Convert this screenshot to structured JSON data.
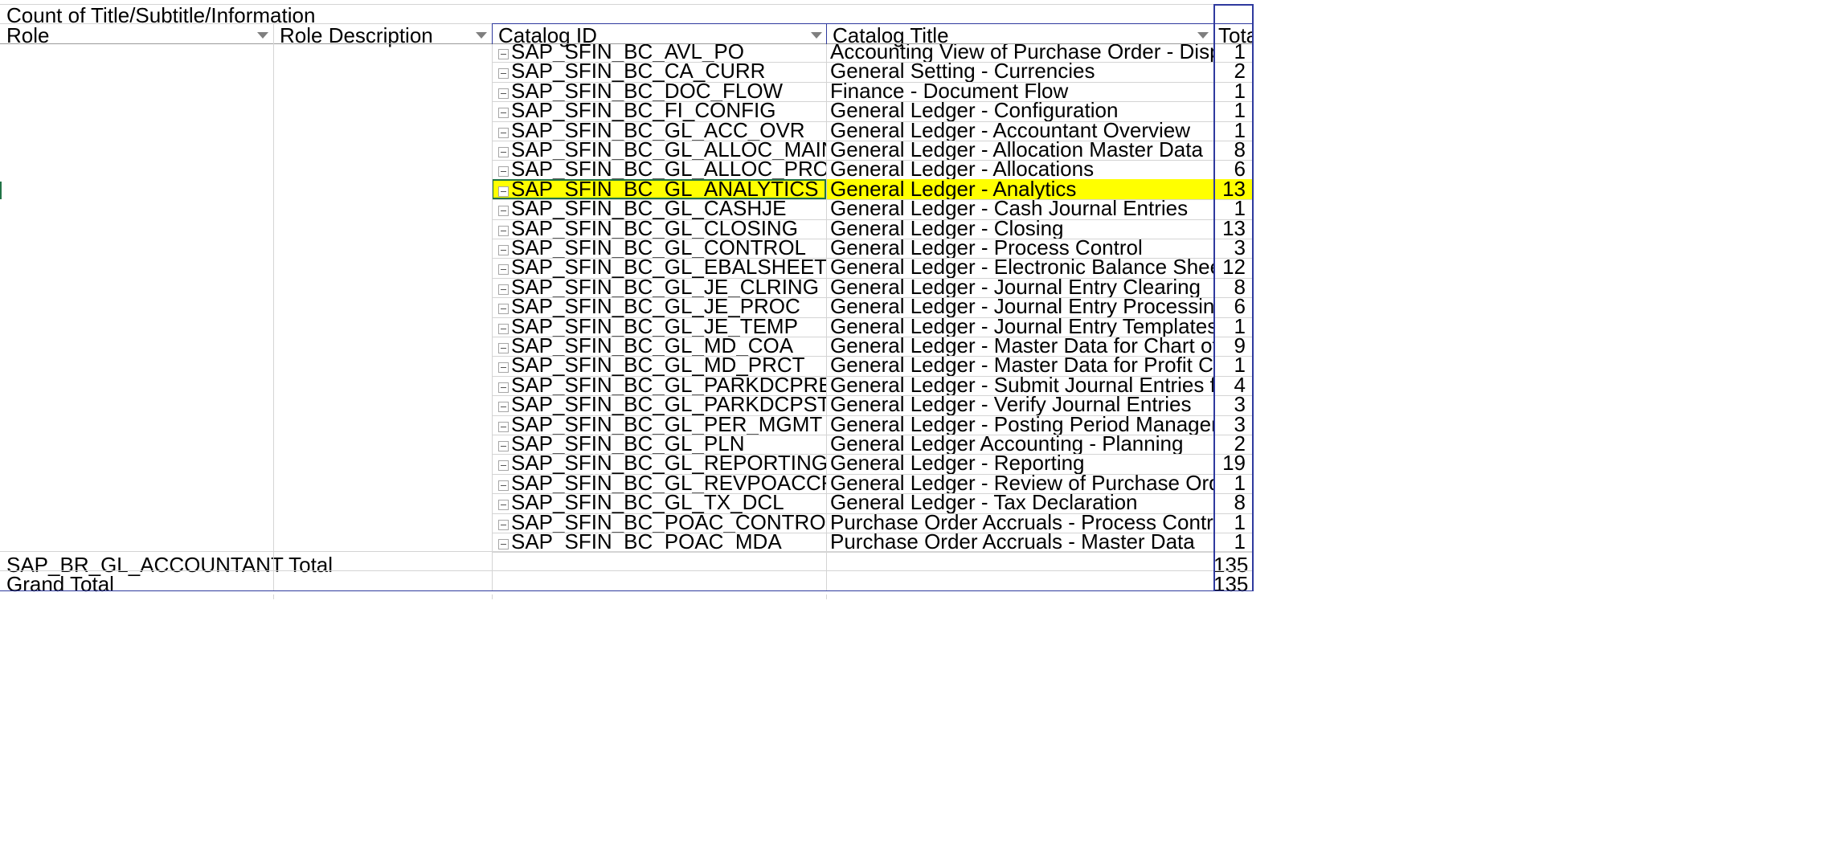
{
  "pivot": {
    "title": "Count of Title/Subtitle/Information",
    "headers": {
      "role": "Role",
      "role_description": "Role Description",
      "catalog_id": "Catalog ID",
      "catalog_title": "Catalog Title",
      "total": "Total"
    },
    "rows": [
      {
        "id": "SAP_SFIN_BC_AVL_PO",
        "title": "Accounting View of Purchase Order - Display",
        "total": "1"
      },
      {
        "id": "SAP_SFIN_BC_CA_CURR",
        "title": "General Setting - Currencies",
        "total": "2"
      },
      {
        "id": "SAP_SFIN_BC_DOC_FLOW",
        "title": "Finance - Document Flow",
        "total": "1"
      },
      {
        "id": "SAP_SFIN_BC_FI_CONFIG",
        "title": "General Ledger - Configuration",
        "total": "1"
      },
      {
        "id": "SAP_SFIN_BC_GL_ACC_OVR",
        "title": "General Ledger - Accountant Overview",
        "total": "1"
      },
      {
        "id": "SAP_SFIN_BC_GL_ALLOC_MAINT",
        "title": "General Ledger - Allocation Master Data",
        "total": "8"
      },
      {
        "id": "SAP_SFIN_BC_GL_ALLOC_PROC",
        "title": "General Ledger - Allocations",
        "total": "6"
      },
      {
        "id": "SAP_SFIN_BC_GL_ANALYTICS",
        "title": "General Ledger - Analytics",
        "total": "13"
      },
      {
        "id": "SAP_SFIN_BC_GL_CASHJE",
        "title": "General Ledger - Cash Journal Entries",
        "total": "1"
      },
      {
        "id": "SAP_SFIN_BC_GL_CLOSING",
        "title": "General Ledger - Closing",
        "total": "13"
      },
      {
        "id": "SAP_SFIN_BC_GL_CONTROL",
        "title": "General Ledger - Process Control",
        "total": "3"
      },
      {
        "id": "SAP_SFIN_BC_GL_EBALSHEET",
        "title": "General Ledger - Electronic Balance Sheet",
        "total": "12"
      },
      {
        "id": "SAP_SFIN_BC_GL_JE_CLRING",
        "title": "General Ledger - Journal Entry Clearing",
        "total": "8"
      },
      {
        "id": "SAP_SFIN_BC_GL_JE_PROC",
        "title": "General Ledger - Journal Entry Processing",
        "total": "6"
      },
      {
        "id": "SAP_SFIN_BC_GL_JE_TEMP",
        "title": "General Ledger - Journal Entry Templates",
        "total": "1"
      },
      {
        "id": "SAP_SFIN_BC_GL_MD_COA",
        "title": "General Ledger - Master Data for Chart of Accounts",
        "total": "9"
      },
      {
        "id": "SAP_SFIN_BC_GL_MD_PRCT",
        "title": "General Ledger - Master Data for Profit Center",
        "total": "1"
      },
      {
        "id": "SAP_SFIN_BC_GL_PARKDCPRE",
        "title": "General Ledger - Submit Journal Entries for Verification",
        "total": "4"
      },
      {
        "id": "SAP_SFIN_BC_GL_PARKDCPST",
        "title": "General Ledger - Verify Journal Entries",
        "total": "3"
      },
      {
        "id": "SAP_SFIN_BC_GL_PER_MGMT",
        "title": "General Ledger - Posting Period Management",
        "total": "3"
      },
      {
        "id": "SAP_SFIN_BC_GL_PLN",
        "title": "General Ledger Accounting - Planning",
        "total": "2"
      },
      {
        "id": "SAP_SFIN_BC_GL_REPORTING",
        "title": "General Ledger - Reporting",
        "total": "19"
      },
      {
        "id": "SAP_SFIN_BC_GL_REVPOACCR",
        "title": "General Ledger - Review of Purchase Order Accruals",
        "total": "1"
      },
      {
        "id": "SAP_SFIN_BC_GL_TX_DCL",
        "title": "General Ledger - Tax Declaration",
        "total": "8"
      },
      {
        "id": "SAP_SFIN_BC_POAC_CONTROL",
        "title": "Purchase Order Accruals - Process Control",
        "total": "1"
      },
      {
        "id": "SAP_SFIN_BC_POAC_MDA",
        "title": "Purchase Order Accruals - Master Data",
        "total": "1"
      }
    ],
    "selected_row": 7,
    "subtotal": {
      "label": "SAP_BR_GL_ACCOUNTANT Total",
      "value": "135"
    },
    "grand_total": {
      "label": "Grand Total",
      "value": "135"
    }
  },
  "colors": {
    "highlight": "#ffff00",
    "selection_border": "#217346",
    "pivot_border": "#2f3a9e",
    "gridline": "#d4d4d4"
  }
}
